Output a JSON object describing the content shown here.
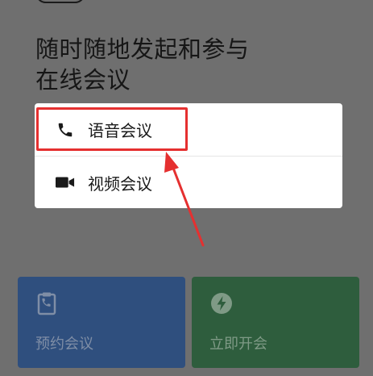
{
  "headline": {
    "line1": "随时随地发起和参与",
    "line2": "在线会议"
  },
  "menu": {
    "items": [
      {
        "label": "语音会议",
        "icon": "phone-icon"
      },
      {
        "label": "视频会议",
        "icon": "video-camera-icon"
      }
    ]
  },
  "cards": {
    "schedule": {
      "label": "预约会议",
      "icon": "calendar-phone-icon"
    },
    "instant": {
      "label": "立即开会",
      "icon": "lightning-icon"
    }
  },
  "colors": {
    "overlay_bg": "#6f6f6f",
    "highlight_red": "#e53030",
    "schedule_card": "#2f4f7e",
    "instant_card": "#2e5d3d"
  }
}
